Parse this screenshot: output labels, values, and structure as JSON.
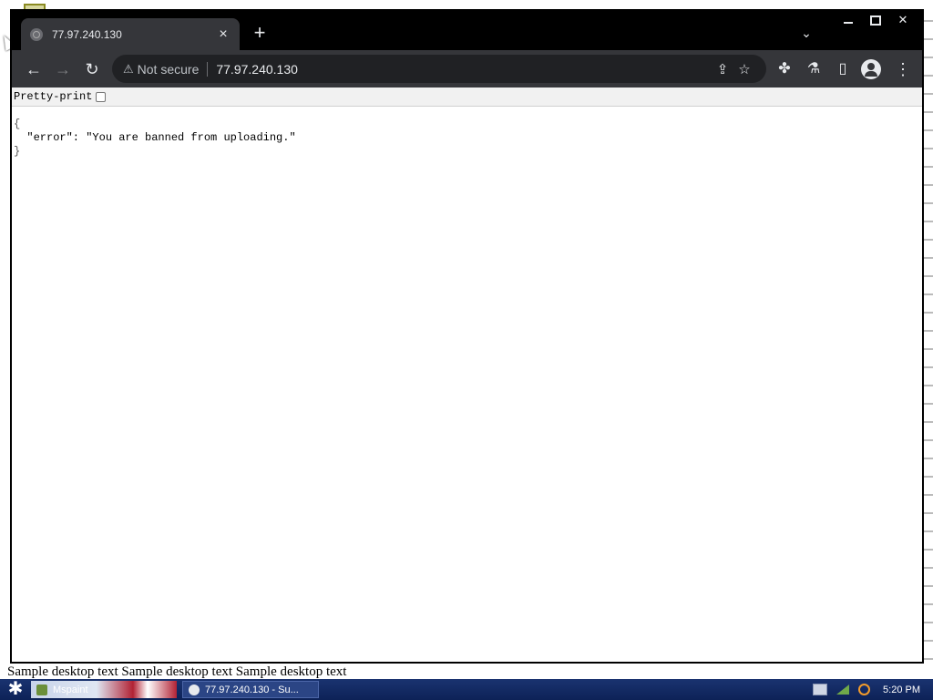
{
  "background_text": "Sample desktop text    Sample desktop text    Sample desktop text",
  "browser": {
    "tab": {
      "title": "77.97.240.130",
      "close_glyph": "×"
    },
    "new_tab_glyph": "+",
    "tab_list_glyph": "⌄",
    "window_controls": {
      "minimize": "",
      "maximize": "",
      "close": "✕"
    },
    "toolbar": {
      "back_glyph": "←",
      "forward_glyph": "→",
      "reload_glyph": "↻",
      "security_label": "Not secure",
      "warning_glyph": "⚠",
      "url": "77.97.240.130",
      "share_glyph": "⇪",
      "bookmark_glyph": "☆",
      "extensions_glyph": "✤",
      "labs_glyph": "⚗",
      "side_panel_glyph": "▯",
      "menu_glyph": "⋮"
    },
    "pretty_print_label": "Pretty-print",
    "json": {
      "open_brace": "{",
      "line": "  \"error\": \"You are banned from uploading.\"",
      "close_brace": "}"
    }
  },
  "taskbar": {
    "start_glyph": "✱",
    "items": [
      {
        "label": "Mspaint"
      },
      {
        "label": "77.97.240.130 - Su..."
      }
    ],
    "clock": "5:20 PM"
  }
}
